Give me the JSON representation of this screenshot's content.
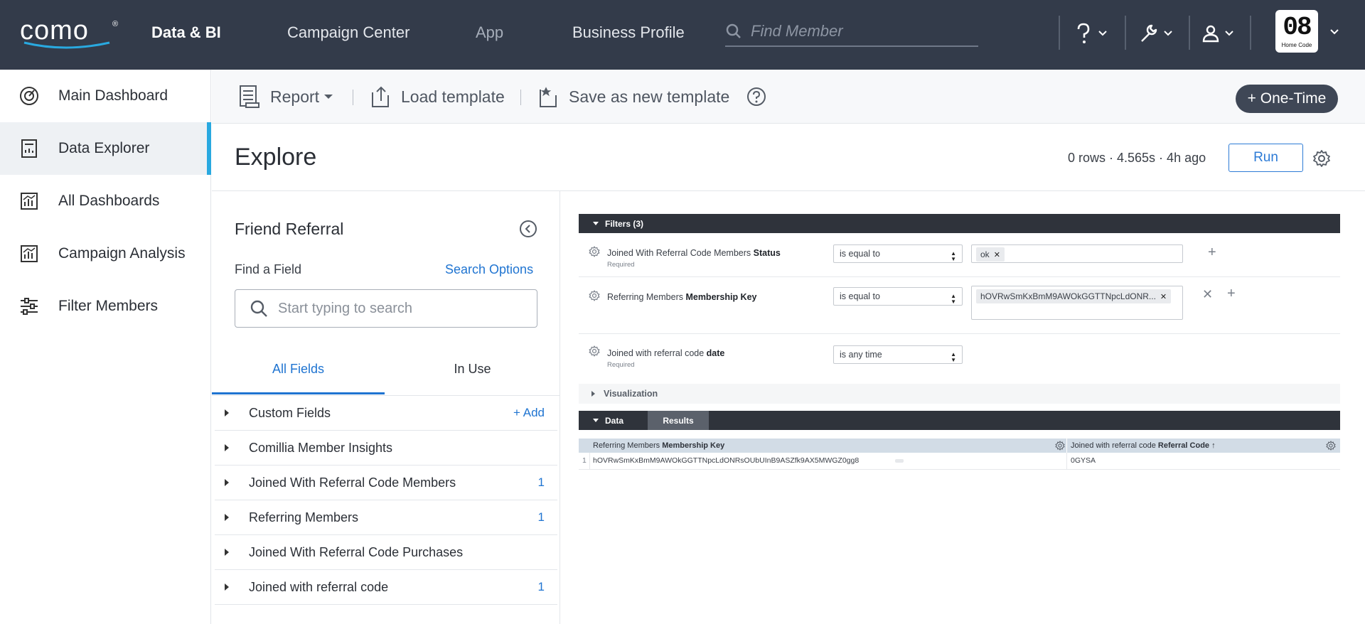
{
  "topbar": {
    "logo": "como",
    "nav": [
      "Data & BI",
      "Campaign Center",
      "App",
      "Business Profile"
    ],
    "search_placeholder": "Find Member",
    "account": {
      "logo_number": "08",
      "logo_caption": "Home Code"
    }
  },
  "sidebar": {
    "items": [
      {
        "label": "Main Dashboard",
        "icon": "gauge-icon"
      },
      {
        "label": "Data Explorer",
        "icon": "calculator-icon",
        "active": true
      },
      {
        "label": "All Dashboards",
        "icon": "chart-icon"
      },
      {
        "label": "Campaign Analysis",
        "icon": "chart-icon"
      },
      {
        "label": "Filter Members",
        "icon": "sliders-icon"
      }
    ]
  },
  "toolbar": {
    "report_label": "Report",
    "load_label": "Load template",
    "save_label": "Save as new template",
    "onetime_label": "+ One-Time"
  },
  "explore": {
    "title": "Explore",
    "stats": "0 rows · 4.565s · 4h ago",
    "run_label": "Run"
  },
  "panel": {
    "title": "Friend Referral",
    "find_label": "Find a Field",
    "search_options": "Search Options",
    "search_placeholder": "Start typing to search",
    "tabs": [
      "All Fields",
      "In Use"
    ],
    "add_label": "+ Add",
    "fields": [
      {
        "name": "Custom Fields",
        "count": ""
      },
      {
        "name": "Comillia Member Insights",
        "count": ""
      },
      {
        "name": "Joined With Referral Code Members",
        "count": "1"
      },
      {
        "name": "Referring Members",
        "count": "1"
      },
      {
        "name": "Joined With Referral Code Purchases",
        "count": ""
      },
      {
        "name": "Joined with referral code",
        "count": "1"
      }
    ]
  },
  "filters": {
    "header": "Filters (3)",
    "rows": [
      {
        "name_prefix": "Joined With Referral Code Members ",
        "name_bold": "Status",
        "required": "Required",
        "operator": "is equal to",
        "value": "ok"
      },
      {
        "name_prefix": "Referring Members ",
        "name_bold": "Membership Key",
        "required": "",
        "operator": "is equal to",
        "value": "hOVRwSmKxBmM9AWOkGGTTNpcLdONR..."
      },
      {
        "name_prefix": "Joined with referral code ",
        "name_bold": "date",
        "required": "Required",
        "operator": "is any time",
        "value": ""
      }
    ]
  },
  "visualization": {
    "label": "Visualization"
  },
  "data": {
    "label": "Data",
    "results_label": "Results",
    "columns": [
      {
        "prefix": "Referring Members ",
        "bold": "Membership Key"
      },
      {
        "prefix": "Joined with referral code ",
        "bold": "Referral Code ↑"
      }
    ],
    "rows": [
      {
        "n": "1",
        "c1": "hOVRwSmKxBmM9AWOkGGTTNpcLdONRsOUbUInB9ASZfk9AX5MWGZ0gg8",
        "c2": "0GYSA"
      }
    ]
  },
  "colors": {
    "topbar": "#333b4a",
    "accent": "#29a9e0",
    "link": "#1f74d1",
    "dark_bar": "#2f333b"
  }
}
